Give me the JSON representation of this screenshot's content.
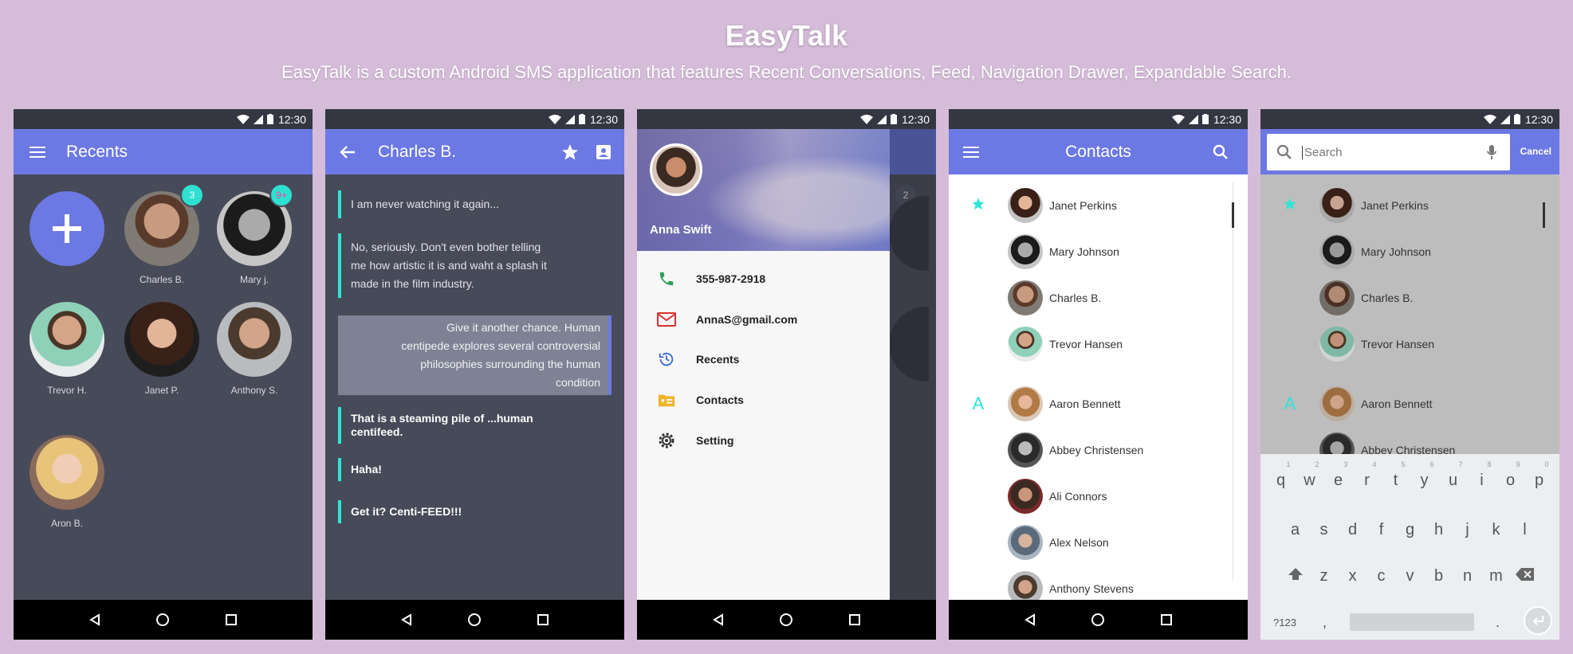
{
  "hero": {
    "title": "EasyTalk",
    "subtitle": "EasyTalk is a custom Android SMS application that features Recent Conversations, Feed, Navigation Drawer, Expandable Search."
  },
  "colors": {
    "background": "#d5bcd9",
    "appbar": "#6c78e3",
    "dark_surface": "#474a58",
    "accent": "#2ee6d8",
    "badge_pink": "#ff3aa3"
  },
  "status_time": "12:30",
  "recents": {
    "title": "Recents",
    "tiles": [
      {
        "name": "Charles B.",
        "badge": "3"
      },
      {
        "name": "Mary j.",
        "badge": "9+"
      },
      {
        "name": "Trevor H."
      },
      {
        "name": "Janet P."
      },
      {
        "name": "Anthony S."
      },
      {
        "name": "Aron B."
      }
    ]
  },
  "chat": {
    "title": "Charles B.",
    "messages": [
      {
        "text": "I am never watching it again..."
      },
      {
        "lines": [
          "No, seriously. Don't even bother telling",
          "me how artistic it is and waht a splash it",
          "made in the film industry."
        ]
      },
      {
        "lines": [
          "Give it another chance. Human",
          "centipede explores several controversial",
          "philosophies surrounding the human",
          "condition"
        ]
      },
      {
        "lines": [
          "That is a steaming pile of ...human",
          "centifeed."
        ]
      },
      {
        "text": "Haha!"
      },
      {
        "text": "Get it? Centi-FEED!!!"
      }
    ]
  },
  "drawer": {
    "user_name": "Anna Swift",
    "badge": "2",
    "items": [
      {
        "label": "355-987-2918",
        "icon": "phone-icon"
      },
      {
        "label": "AnnaS@gmail.com",
        "icon": "mail-icon"
      },
      {
        "label": "Recents",
        "icon": "history-icon"
      },
      {
        "label": "Contacts",
        "icon": "contact-card-icon"
      },
      {
        "label": "Setting",
        "icon": "gear-icon"
      }
    ]
  },
  "contacts": {
    "title": "Contacts",
    "section_letter": "A",
    "favorites": [
      "Janet Perkins",
      "Mary Johnson",
      "Charles B.",
      "Trevor Hansen"
    ],
    "a_list": [
      "Aaron Bennett",
      "Abbey Christensen",
      "Ali Connors",
      "Alex Nelson",
      "Anthony Stevens"
    ]
  },
  "search": {
    "placeholder": "Search",
    "cancel": "Cancel",
    "keyboard": {
      "row1": [
        "q",
        "w",
        "e",
        "r",
        "t",
        "y",
        "u",
        "i",
        "o",
        "p"
      ],
      "row1_hints": [
        "1",
        "2",
        "3",
        "4",
        "5",
        "6",
        "7",
        "8",
        "9",
        "0"
      ],
      "row2": [
        "a",
        "s",
        "d",
        "f",
        "g",
        "h",
        "j",
        "k",
        "l"
      ],
      "row3": [
        "z",
        "x",
        "c",
        "v",
        "b",
        "n",
        "m"
      ],
      "symbols": "?123",
      "comma": ",",
      "period": "."
    }
  }
}
